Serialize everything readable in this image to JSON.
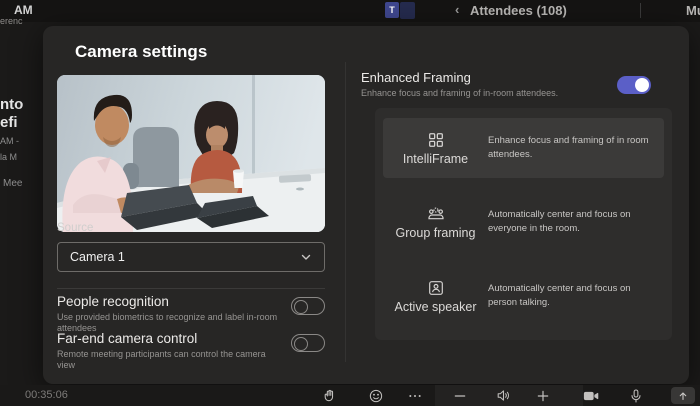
{
  "top_bar": {
    "time_fragment": "AM",
    "overflow_fragment": "erenc",
    "teams_logo_letter": "T",
    "attendees_label": "Attendees (108)",
    "back_chevron": "‹",
    "mute_fragment": "Mu"
  },
  "background_panel": {
    "fragment_1": "nto",
    "fragment_2": "efi",
    "fragment_3": "AM -",
    "fragment_4": "la M",
    "fragment_5": "Mee"
  },
  "dialog": {
    "title": "Camera settings",
    "source_label": "Source",
    "source_value": "Camera 1",
    "people_recognition": {
      "label": "People recognition",
      "description": "Use provided biometrics to recognize and label in-room attendees",
      "state": "off"
    },
    "far_end_camera_control": {
      "label": "Far-end camera control",
      "description": "Remote meeting participants can control the camera view",
      "state": "off"
    },
    "enhanced_framing": {
      "label": "Enhanced Framing",
      "description": "Enhance focus and framing of in-room attendees.",
      "state": "on"
    },
    "framing_options": [
      {
        "label": "IntelliFrame",
        "description": "Enhance focus and framing of in room attendees.",
        "icon": "grid-icon",
        "selected": true
      },
      {
        "label": "Group framing",
        "description": "Automatically center and focus on everyone in the room.",
        "icon": "group-icon",
        "selected": false
      },
      {
        "label": "Active speaker",
        "description": "Automatically center and focus on person talking.",
        "icon": "person-frame-icon",
        "selected": false
      }
    ]
  },
  "bottom_bar": {
    "timer": "00:35:06",
    "icons": [
      "raised-hand-icon",
      "emoji-icon",
      "more-icon",
      "minus-icon",
      "speaker-icon",
      "plus-icon",
      "camera-icon",
      "microphone-icon",
      "share-icon"
    ]
  },
  "colors": {
    "accent": "#5b5fc7",
    "dialog_bg": "#272625",
    "panel_bg": "#2e2d2c",
    "selected_card_bg": "#3b3a39"
  }
}
